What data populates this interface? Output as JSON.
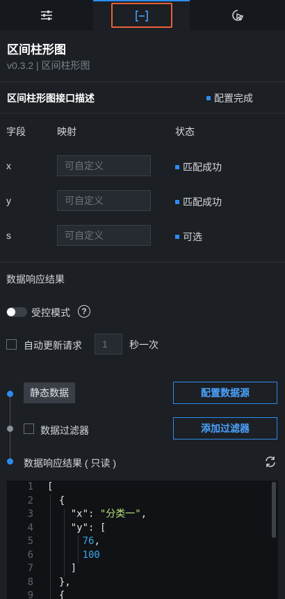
{
  "tabs": {
    "items": [
      {
        "icon": "sliders-icon"
      },
      {
        "icon": "bracket-interface-icon",
        "active": true
      },
      {
        "icon": "interaction-icon"
      }
    ]
  },
  "header": {
    "title": "区间柱形图",
    "subtitle": "v0.3.2 | 区间柱形图"
  },
  "interface": {
    "title": "区间柱形图接口描述",
    "status": "配置完成",
    "columns": {
      "field": "字段",
      "mapping": "映射",
      "status": "状态"
    },
    "rows": [
      {
        "field": "x",
        "placeholder": "可自定义",
        "status": "匹配成功"
      },
      {
        "field": "y",
        "placeholder": "可自定义",
        "status": "匹配成功"
      },
      {
        "field": "s",
        "placeholder": "可自定义",
        "status": "可选"
      }
    ]
  },
  "response": {
    "title": "数据响应结果",
    "controlled_label": "受控模式",
    "auto_update_label": "自动更新请求",
    "interval_placeholder": "1",
    "interval_unit": "秒一次",
    "static_data_label": "静态数据",
    "config_source_label": "配置数据源",
    "filter_label": "数据过滤器",
    "add_filter_label": "添加过滤器",
    "result_label": "数据响应结果 ( 只读 )"
  },
  "code": {
    "line_numbers": [
      "1",
      "2",
      "3",
      "4",
      "5",
      "6",
      "7",
      "8",
      "9"
    ],
    "open_bracket": "[",
    "open_brace": "{",
    "key_x": "\"x\"",
    "colon": ": ",
    "val_x": "\"分类一\"",
    "comma": ",",
    "key_y": "\"y\"",
    "y_open": "[",
    "y_v1": "76",
    "y_v2": "100",
    "y_close": "]",
    "close_brace": "},",
    "next_brace": "{"
  },
  "colors": {
    "accent": "#2d8cf0",
    "highlight_box": "#e8613a",
    "string": "#b5e27a",
    "number": "#3ba7e6"
  }
}
